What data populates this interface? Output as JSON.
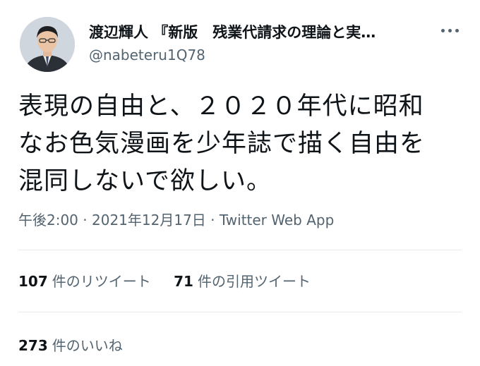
{
  "author": {
    "display_name": "渡辺輝人 『新版　残業代請求の理論と実…",
    "handle": "@nabeteru1Q78"
  },
  "tweet": {
    "text_line1": "表現の自由と、２０２０年代に昭和",
    "text_line2": "なお色気漫画を少年誌で描く自由を",
    "text_line3": "混同しないで欲しい。",
    "time": "午後2:00",
    "separator1": "·",
    "date": "2021年12月17日",
    "separator2": "·",
    "source": "Twitter Web App"
  },
  "stats": {
    "retweets_count": "107",
    "retweets_label": "件のリツイート",
    "quotes_count": "71",
    "quotes_label": "件の引用ツイート",
    "likes_count": "273",
    "likes_label": "件のいいね"
  },
  "icons": {
    "more": "more-horizontal-icon"
  },
  "colors": {
    "text": "#0f1419",
    "secondary": "#536471",
    "divider": "#e6ecf0"
  }
}
